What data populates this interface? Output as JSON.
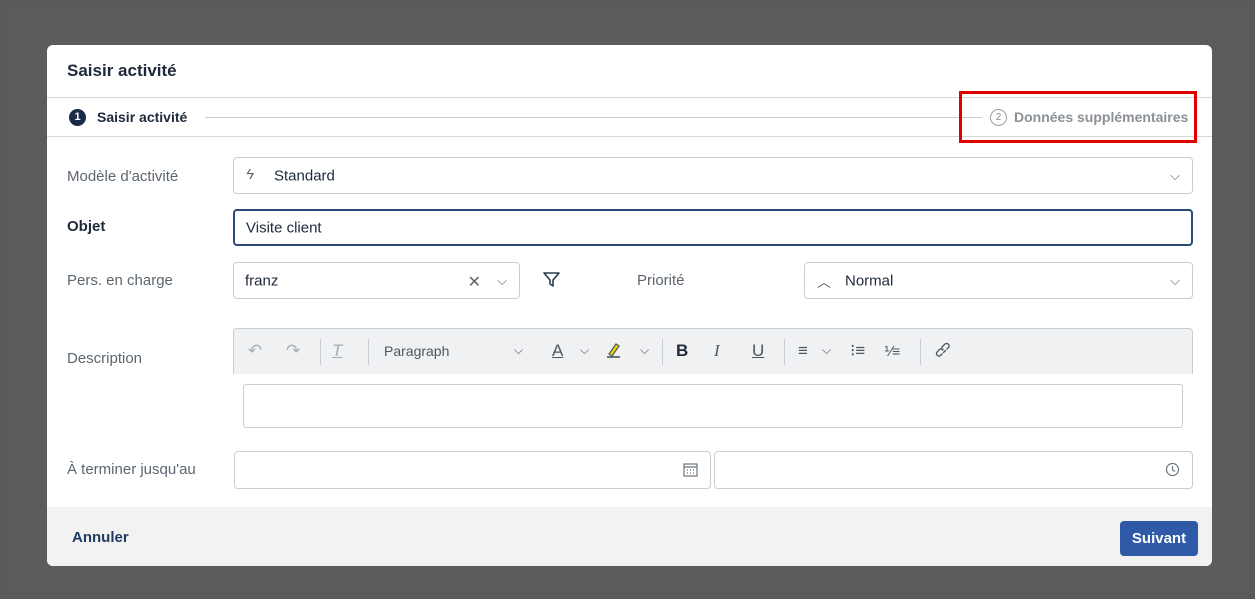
{
  "dialog": {
    "title": "Saisir activité"
  },
  "stepper": {
    "step1": {
      "number": "1",
      "label": "Saisir activité"
    },
    "step2": {
      "number": "2",
      "label": "Données supplémentaires"
    }
  },
  "form": {
    "template": {
      "label": "Modèle d'activité",
      "value": "Standard"
    },
    "subject": {
      "label": "Objet",
      "value": "Visite client"
    },
    "assignee": {
      "label": "Pers. en charge",
      "value": "franz"
    },
    "priority": {
      "label": "Priorité",
      "value": "Normal"
    },
    "description": {
      "label": "Description",
      "paragraph_style": "Paragraph"
    },
    "due": {
      "label": "À terminer jusqu'au",
      "date_value": "",
      "time_value": ""
    }
  },
  "footer": {
    "cancel_label": "Annuler",
    "next_label": "Suivant"
  },
  "colors": {
    "primary": "#2e5aa8",
    "highlight": "#e00000",
    "dark": "#1a2b45"
  }
}
